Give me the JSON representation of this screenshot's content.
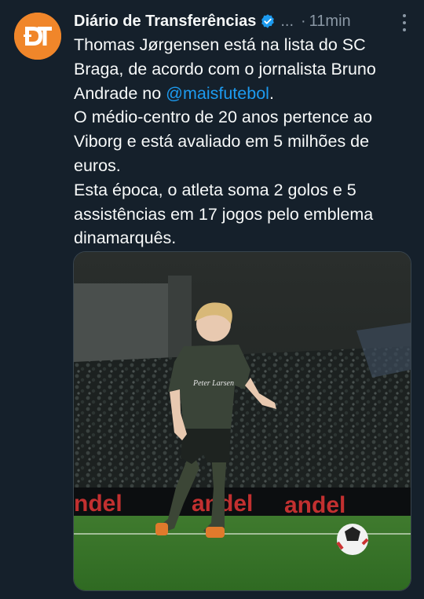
{
  "tweet": {
    "author_name": "Diário de Transferências",
    "verified": true,
    "handle_truncated": "...",
    "separator": "·",
    "time": "11min",
    "avatar_text": "DT",
    "avatar_color": "#f0862a",
    "text": {
      "p1_before": "Thomas Jørgensen está na lista do SC Braga, de acordo com o jornalista Bruno Andrade no ",
      "p1_mention": "@maisfutebol",
      "p1_after": ".",
      "p2": "O médio-centro de 20 anos pertence ao Viborg e está avaliado em 5 milhões de euros.",
      "p3": "Esta época, o atleta soma 2 golos e 5 assistências em 17 jogos pelo emblema dinamarquês."
    },
    "media": {
      "description_icon": "photo",
      "board_texts": [
        "andel",
        "andel",
        "andel"
      ]
    }
  },
  "colors": {
    "background": "#15202b",
    "text": "#f7f9f9",
    "muted": "#8b98a5",
    "link": "#1d9bf0",
    "verified": "#1d9bf0"
  }
}
